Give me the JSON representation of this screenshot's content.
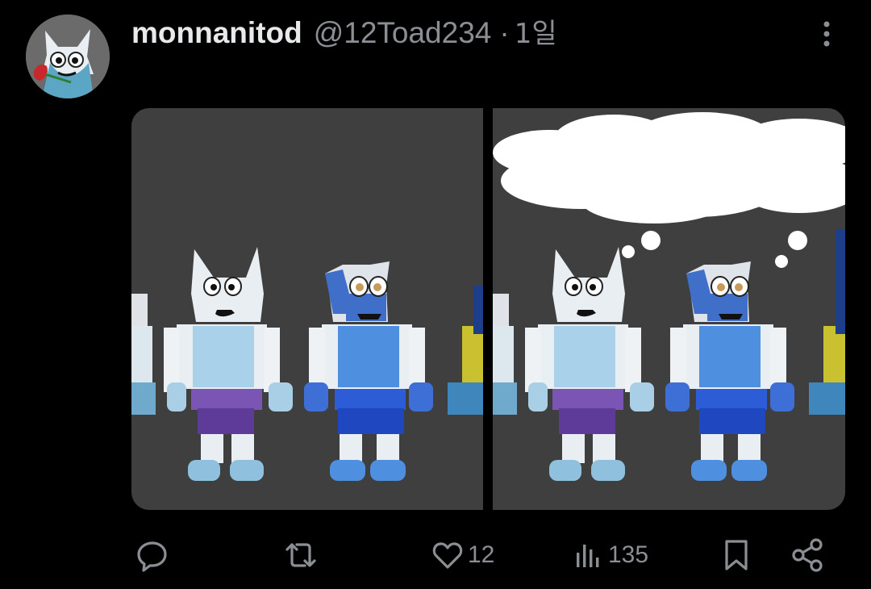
{
  "tweet": {
    "author_name": "monnanitod",
    "handle": "@12Toad234",
    "separator": "·",
    "time": "1일"
  },
  "media": {
    "left_panel": "character-lineup",
    "right_panel": "character-lineup-with-thought-bubble"
  },
  "actions": {
    "reply_icon": "reply-icon",
    "retweet_icon": "retweet-icon",
    "like_icon": "heart-icon",
    "like_count": "12",
    "views_icon": "views-icon",
    "view_count": "135",
    "bookmark_icon": "bookmark-icon",
    "share_icon": "share-icon"
  },
  "colors": {
    "background": "#000000",
    "primary_text": "#e7e9ea",
    "secondary_text": "#8b8f94",
    "scene_background": "#3f3f3f"
  }
}
